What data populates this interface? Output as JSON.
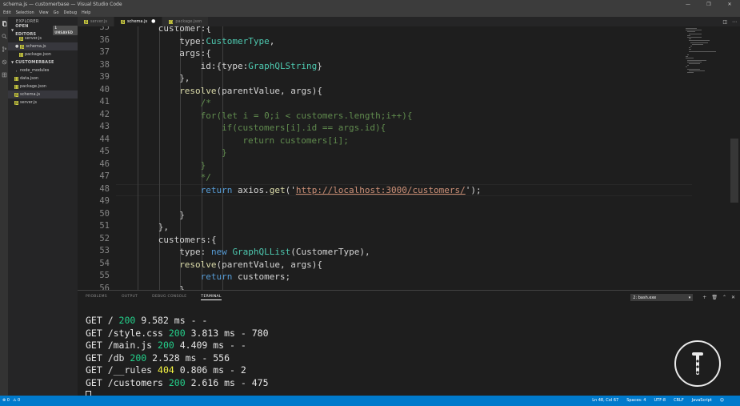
{
  "window": {
    "title": "schema.js — customerbase — Visual Studio Code",
    "controls": [
      "—",
      "❐",
      "✕"
    ]
  },
  "menu": [
    "Edit",
    "Selection",
    "View",
    "Go",
    "Debug",
    "Help"
  ],
  "sidebar": {
    "title": "EXPLORER",
    "open_editors": {
      "label": "OPEN EDITORS",
      "badge": "1 UNSAVED"
    },
    "open_files": [
      {
        "name": "server.js",
        "type": "js"
      },
      {
        "name": "schema.js",
        "type": "js",
        "modified": "●"
      },
      {
        "name": "package.json",
        "type": "json"
      }
    ],
    "project": {
      "label": "CUSTOMERBASE"
    },
    "files": [
      {
        "name": "node_modules",
        "type": "folder"
      },
      {
        "name": "data.json",
        "type": "json"
      },
      {
        "name": "package.json",
        "type": "json"
      },
      {
        "name": "schema.js",
        "type": "js"
      },
      {
        "name": "server.js",
        "type": "js"
      }
    ]
  },
  "tabs": [
    {
      "label": "server.js",
      "active": false
    },
    {
      "label": "schema.js",
      "active": true,
      "modified": "●"
    },
    {
      "label": "package.json",
      "active": false
    }
  ],
  "editor": {
    "line_numbers": [
      "35",
      "36",
      "37",
      "38",
      "39",
      "40",
      "41",
      "42",
      "43",
      "44",
      "45",
      "46",
      "47",
      "48",
      "49",
      "50",
      "51",
      "52",
      "53",
      "54",
      "55",
      "56"
    ],
    "lines": [
      {
        "indent": 2,
        "tokens": [
          [
            "p",
            "customer:{"
          ]
        ]
      },
      {
        "indent": 3,
        "tokens": [
          [
            "p",
            "type:"
          ],
          [
            "ty",
            "CustomerType"
          ],
          [
            "p",
            ","
          ]
        ]
      },
      {
        "indent": 3,
        "tokens": [
          [
            "p",
            "args:{"
          ]
        ]
      },
      {
        "indent": 4,
        "tokens": [
          [
            "p",
            "id:{type:"
          ],
          [
            "ty",
            "GraphQLString"
          ],
          [
            "p",
            "}"
          ]
        ]
      },
      {
        "indent": 3,
        "tokens": [
          [
            "p",
            "},"
          ]
        ]
      },
      {
        "indent": 3,
        "tokens": [
          [
            "fn",
            "resolve"
          ],
          [
            "p",
            "(parentValue, args){"
          ]
        ]
      },
      {
        "indent": 4,
        "tokens": [
          [
            "c",
            "/*"
          ]
        ]
      },
      {
        "indent": 4,
        "tokens": [
          [
            "c",
            "for(let i = 0;i < customers.length;i++){"
          ]
        ]
      },
      {
        "indent": 5,
        "tokens": [
          [
            "c",
            "if(customers[i].id == args.id){"
          ]
        ]
      },
      {
        "indent": 6,
        "tokens": [
          [
            "c",
            "return customers[i];"
          ]
        ]
      },
      {
        "indent": 5,
        "tokens": [
          [
            "c",
            "}"
          ]
        ]
      },
      {
        "indent": 4,
        "tokens": [
          [
            "c",
            "}"
          ]
        ]
      },
      {
        "indent": 4,
        "tokens": [
          [
            "c",
            "*/"
          ]
        ]
      },
      {
        "indent": 4,
        "tokens": [
          [
            "k",
            "return "
          ],
          [
            "p",
            "axios."
          ],
          [
            "fn",
            "get"
          ],
          [
            "p",
            "("
          ],
          [
            "sq",
            "'"
          ],
          [
            "s",
            "http://localhost:3000/customers/"
          ],
          [
            "sq",
            "'"
          ],
          [
            "p",
            ");"
          ]
        ]
      },
      {
        "indent": 0,
        "tokens": []
      },
      {
        "indent": 3,
        "tokens": [
          [
            "p",
            "}"
          ]
        ]
      },
      {
        "indent": 2,
        "tokens": [
          [
            "p",
            "},"
          ]
        ]
      },
      {
        "indent": 2,
        "tokens": [
          [
            "p",
            "customers:{"
          ]
        ]
      },
      {
        "indent": 3,
        "tokens": [
          [
            "p",
            "type: "
          ],
          [
            "k",
            "new "
          ],
          [
            "ty",
            "GraphQLList"
          ],
          [
            "p",
            "(CustomerType),"
          ]
        ]
      },
      {
        "indent": 3,
        "tokens": [
          [
            "fn",
            "resolve"
          ],
          [
            "p",
            "(parentValue, args){"
          ]
        ]
      },
      {
        "indent": 4,
        "tokens": [
          [
            "k",
            "return "
          ],
          [
            "p",
            "customers;"
          ]
        ]
      },
      {
        "indent": 3,
        "tokens": [
          [
            "p",
            "}"
          ]
        ]
      }
    ]
  },
  "panel": {
    "tabs": [
      "PROBLEMS",
      "OUTPUT",
      "DEBUG CONSOLE",
      "TERMINAL"
    ],
    "active_tab": "TERMINAL",
    "terminal_select": "2: bash.exe",
    "actions": [
      "+",
      "🗑",
      "⌃",
      "✕"
    ],
    "terminal_lines": [
      {
        "pre": "GET / ",
        "status": "200",
        "post": " 9.582 ms - -"
      },
      {
        "pre": "GET /style.css ",
        "status": "200",
        "post": " 3.813 ms - 780"
      },
      {
        "pre": "GET /main.js ",
        "status": "200",
        "post": " 4.409 ms - -"
      },
      {
        "pre": "GET /db ",
        "status": "200",
        "post": " 2.528 ms - 556"
      },
      {
        "pre": "GET /__rules ",
        "status": "404",
        "post": " 0.806 ms - 2"
      },
      {
        "pre": "GET /customers ",
        "status": "200",
        "post": " 2.616 ms - 475"
      }
    ]
  },
  "statusbar": {
    "left": [
      "⊗ 0",
      "⚠ 0"
    ],
    "right": [
      "Ln 48, Col 67",
      "Spaces: 4",
      "UTF-8",
      "CRLF",
      "JavaScript",
      "☺"
    ]
  },
  "colors": {
    "status_bg": "#007acc",
    "status_200": "#23d18b",
    "status_404": "#f5f543"
  }
}
